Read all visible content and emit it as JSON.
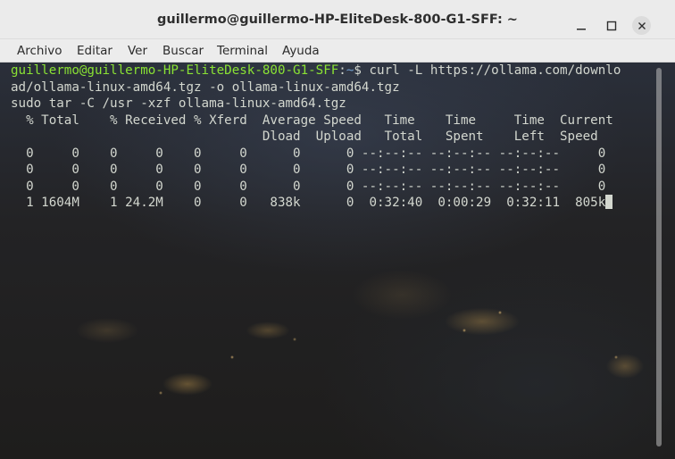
{
  "window": {
    "title": "guillermo@guillermo-HP-EliteDesk-800-G1-SFF: ~",
    "minimize_icon": "minimize-icon",
    "maximize_icon": "maximize-icon",
    "close_icon": "close-icon"
  },
  "menu": {
    "items": [
      {
        "label": "Archivo"
      },
      {
        "label": "Editar"
      },
      {
        "label": "Ver"
      },
      {
        "label": "Buscar"
      },
      {
        "label": "Terminal"
      },
      {
        "label": "Ayuda"
      }
    ]
  },
  "terminal": {
    "prompt_user": "guillermo@guillermo-HP-EliteDesk-800-G1-SFF",
    "prompt_sep": ":",
    "prompt_path": "~",
    "prompt_symbol": "$ ",
    "command_line1": "curl -L https://ollama.com/downlo",
    "command_line2": "ad/ollama-linux-amd64.tgz -o ollama-linux-amd64.tgz",
    "command_line3": "sudo tar -C /usr -xzf ollama-linux-amd64.tgz",
    "header1": "  % Total    % Received % Xferd  Average Speed   Time    Time     Time  Current",
    "header2": "                                 Dload  Upload   Total   Spent    Left  Speed",
    "rows": [
      "  0     0    0     0    0     0      0      0 --:--:-- --:--:-- --:--:--     0",
      "  0     0    0     0    0     0      0      0 --:--:-- --:--:-- --:--:--     0",
      "  0     0    0     0    0     0      0      0 --:--:-- --:--:-- --:--:--     0"
    ],
    "progress_row": "  1 1604M    1 24.2M    0     0   838k      0  0:32:40  0:00:29  0:32:11  805k"
  },
  "colors": {
    "prompt_user": "#8ae234",
    "prompt_path": "#729fcf",
    "text": "#d3d7cf"
  }
}
